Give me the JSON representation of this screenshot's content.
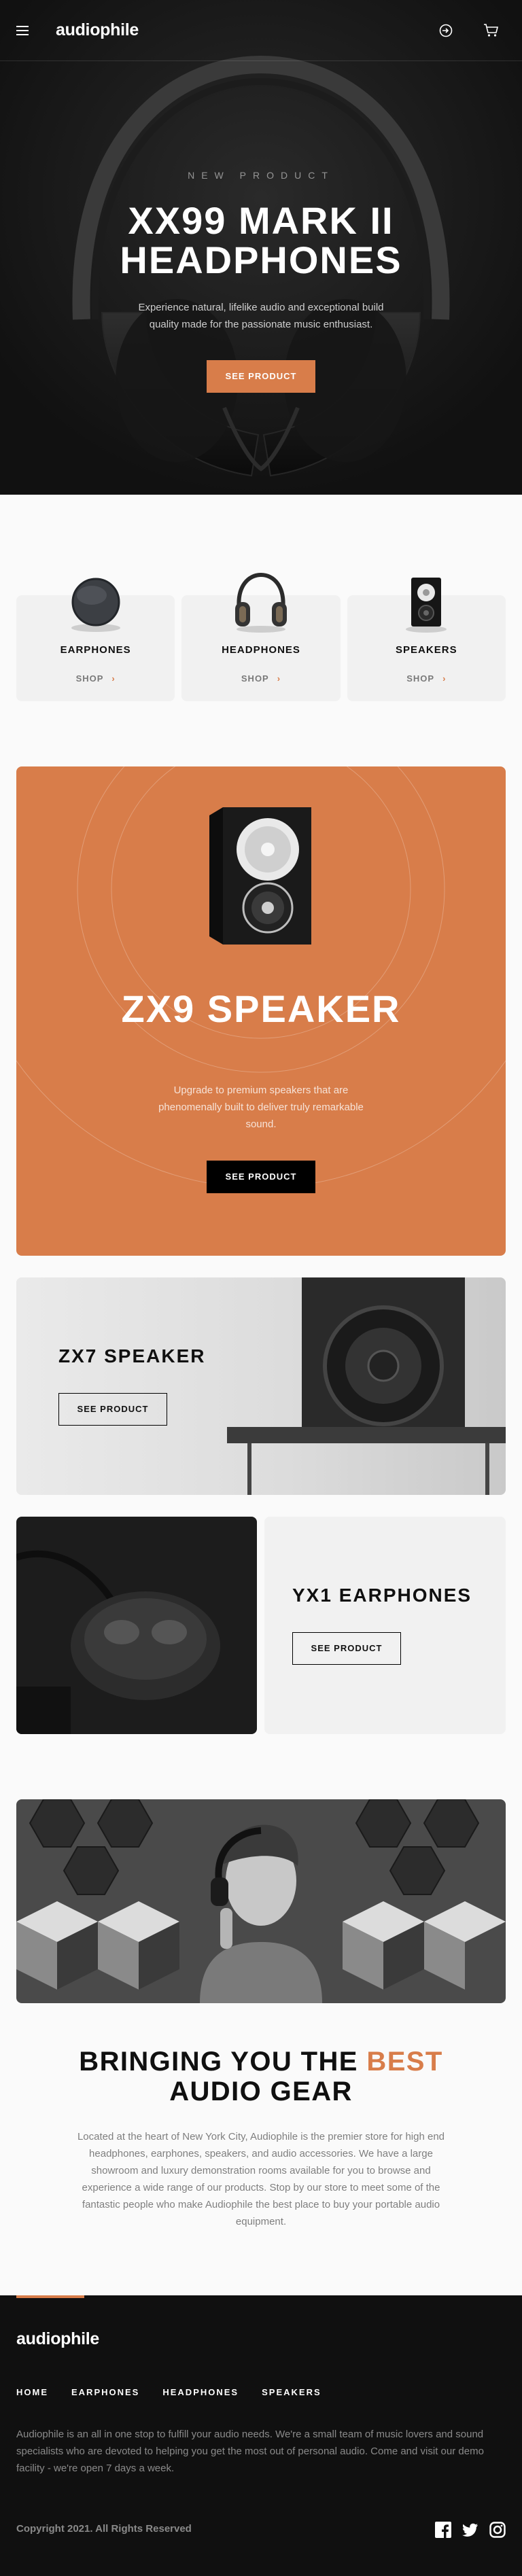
{
  "header": {
    "logo": "audiophile",
    "menu_icon": "hamburger-menu-icon",
    "login_icon": "login-arrow-icon",
    "cart_icon": "cart-icon"
  },
  "hero": {
    "overline": "NEW PRODUCT",
    "title": "XX99 MARK II HEADPHONES",
    "description": "Experience natural, lifelike audio and exceptional build quality made for the passionate music enthusiast.",
    "cta": "SEE PRODUCT"
  },
  "categories": [
    {
      "name": "EARPHONES",
      "shop": "SHOP"
    },
    {
      "name": "HEADPHONES",
      "shop": "SHOP"
    },
    {
      "name": "SPEAKERS",
      "shop": "SHOP"
    }
  ],
  "zx9": {
    "title": "ZX9 SPEAKER",
    "description": "Upgrade to premium speakers that are phenomenally built to deliver truly remarkable sound.",
    "cta": "SEE PRODUCT"
  },
  "zx7": {
    "title": "ZX7 SPEAKER",
    "cta": "SEE PRODUCT"
  },
  "yx1": {
    "title": "YX1 EARPHONES",
    "cta": "SEE PRODUCT"
  },
  "about": {
    "title_before": "BRINGING YOU THE ",
    "title_accent": "BEST",
    "title_after": " AUDIO GEAR",
    "description": "Located at the heart of New York City, Audiophile is the premier store for high end headphones, earphones, speakers, and audio accessories. We have a large showroom and luxury demonstration rooms available for you to browse and experience a wide range of our products. Stop by our store to meet some of the fantastic people who make Audiophile the best place to buy your portable audio equipment."
  },
  "footer": {
    "logo": "audiophile",
    "nav": [
      "HOME",
      "EARPHONES",
      "HEADPHONES",
      "SPEAKERS"
    ],
    "description": "Audiophile is an all in one stop to fulfill your audio needs. We're a small team of music lovers and sound specialists who are devoted to helping you get the most out of personal audio. Come and visit our demo facility - we're open 7 days a week.",
    "copyright": "Copyright 2021. All Rights Reserved",
    "socials": [
      "facebook-icon",
      "twitter-icon",
      "instagram-icon"
    ]
  },
  "colors": {
    "accent": "#d87d4a",
    "dark": "#101010",
    "light_gray": "#f1f1f1",
    "page_bg": "#fafafa"
  }
}
